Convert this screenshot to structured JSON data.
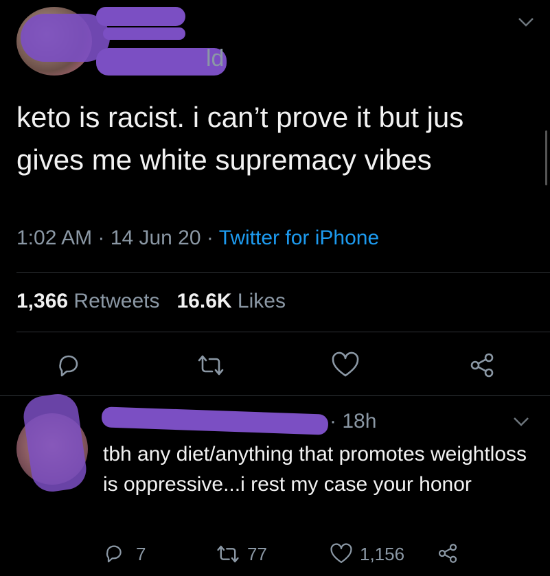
{
  "tweet": {
    "author_suffix": "ld",
    "text": "keto is racist. i can’t prove it but jus gives me white supremacy vibes",
    "time": "1:02 AM",
    "sep1": "·",
    "date": "14 Jun 20",
    "sep2": "·",
    "source": "Twitter for iPhone",
    "retweets_count": "1,366",
    "retweets_label": "Retweets",
    "likes_count": "16.6K",
    "likes_label": "Likes",
    "actions": [
      "reply-icon",
      "retweet-icon",
      "like-icon",
      "share-icon"
    ]
  },
  "reply": {
    "age": "18h",
    "text": "tbh any diet/anything that promotes weightloss is oppressive...i rest my case your honor",
    "reply_count": "7",
    "retweet_count": "77",
    "like_count": "1,156",
    "actions": [
      "reply-icon",
      "retweet-icon",
      "like-icon",
      "share-icon"
    ]
  },
  "colors": {
    "background": "#000000",
    "text": "#f2f2f2",
    "muted": "#8b98a5",
    "link": "#1d9bf0",
    "redaction": "#7b4fc3"
  }
}
